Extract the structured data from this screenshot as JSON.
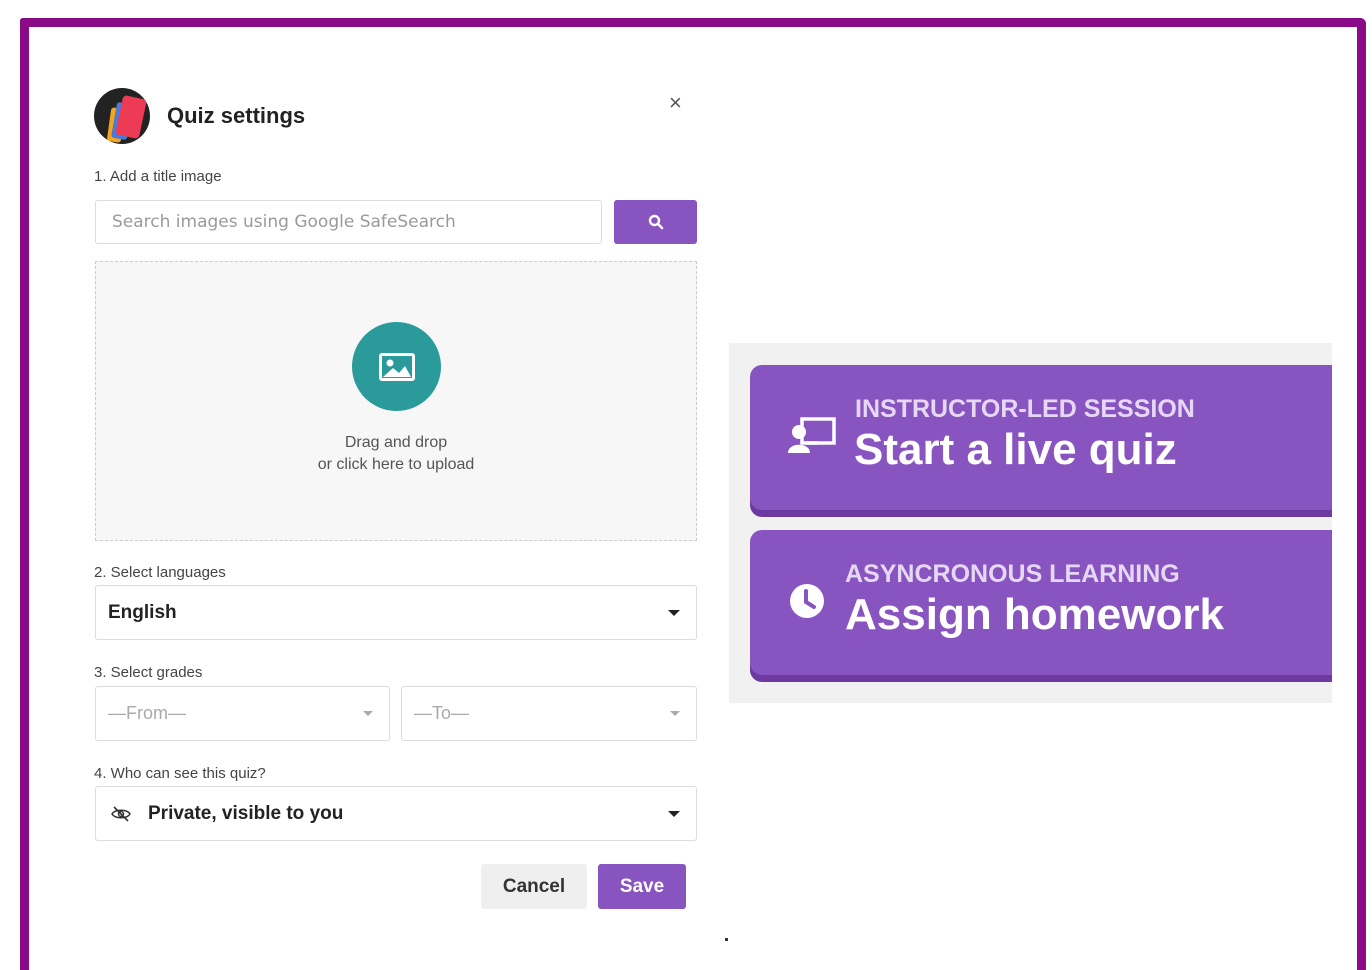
{
  "modal": {
    "title": "Quiz settings",
    "close_label": "×",
    "step1_label": "1. Add a title image",
    "search_placeholder": "Search images using Google SafeSearch",
    "search_button_icon": "search-icon",
    "upload_icon": "image-icon",
    "upload_line1": "Drag and drop",
    "upload_line2": "or click here to upload",
    "step2_label": "2. Select languages",
    "language_value": "English",
    "step3_label": "3. Select grades",
    "grade_from_placeholder": "—From—",
    "grade_to_placeholder": "—To—",
    "step4_label": "4. Who can see this quiz?",
    "visibility_icon": "eye-slash-icon",
    "visibility_value": "Private, visible to you",
    "cancel_label": "Cancel",
    "save_label": "Save"
  },
  "actions": {
    "live": {
      "icon": "presentation-icon",
      "subtitle": "INSTRUCTOR-LED SESSION",
      "title": "Start a live quiz"
    },
    "homework": {
      "icon": "clock-icon",
      "subtitle": "ASYNCRONOUS LEARNING",
      "title": "Assign homework"
    }
  },
  "colors": {
    "frame_border": "#8b0a87",
    "accent_purple": "#8854c0",
    "teal": "#2b9a9a"
  }
}
